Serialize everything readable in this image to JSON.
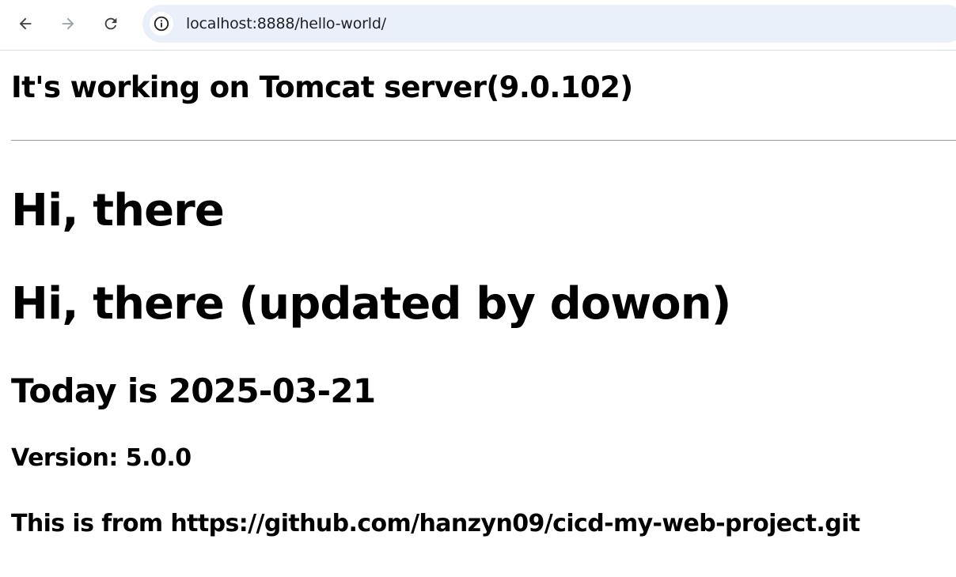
{
  "browser": {
    "address_bar": {
      "url": "localhost:8888/hello-world/"
    },
    "icons": {
      "back": "arrow-left-icon",
      "forward": "arrow-right-icon",
      "reload": "reload-icon",
      "site_info": "info-circle-icon"
    },
    "colors": {
      "omnibox_bg": "#eaf0fa",
      "forward_disabled": "#9aa0a6"
    }
  },
  "page": {
    "server_heading": "It's working on Tomcat server(9.0.102)",
    "greeting": "Hi, there",
    "greeting_updated": "Hi, there (updated by dowon)",
    "today": "Today is 2025-03-21",
    "version": "Version: 5.0.0",
    "source": "This is from https://github.com/hanzyn09/cicd-my-web-project.git"
  }
}
